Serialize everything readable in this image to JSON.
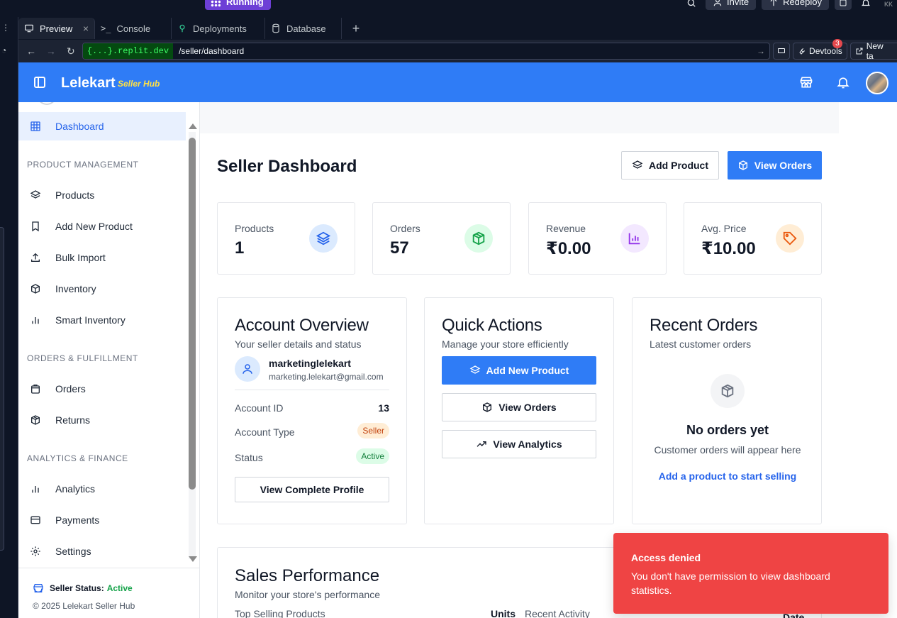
{
  "replit": {
    "run_status": "Running",
    "invite_label": "Invite",
    "redeploy_label": "Redeploy",
    "tabs": [
      {
        "label": "Preview",
        "icon": "monitor-icon"
      },
      {
        "label": "Console",
        "icon": "terminal-icon"
      },
      {
        "label": "Deployments",
        "icon": "deploy-icon"
      },
      {
        "label": "Database",
        "icon": "database-icon"
      }
    ],
    "url_domain": "{...}.replit.dev",
    "url_path": "/seller/dashboard",
    "devtools_label": "Devtools",
    "devtools_badge": "3",
    "new_tab_label": "New ta",
    "avatar_initials": "KK"
  },
  "header": {
    "brand": "Lelekart",
    "brand_sub": "Seller Hub",
    "accent": "#2f7cf6"
  },
  "sidebar": {
    "items": [
      {
        "label": "Dashboard",
        "icon": "grid-icon"
      },
      {
        "label": "Products",
        "icon": "layers-icon"
      },
      {
        "label": "Add New Product",
        "icon": "bookmark-icon"
      },
      {
        "label": "Bulk Import",
        "icon": "upload-icon"
      },
      {
        "label": "Inventory",
        "icon": "box-icon"
      },
      {
        "label": "Smart Inventory",
        "icon": "bar-chart-icon"
      },
      {
        "label": "Orders",
        "icon": "shopping-bag-icon"
      },
      {
        "label": "Returns",
        "icon": "package-icon"
      },
      {
        "label": "Analytics",
        "icon": "bar-chart-icon"
      },
      {
        "label": "Payments",
        "icon": "credit-card-icon"
      },
      {
        "label": "Settings",
        "icon": "gear-icon"
      }
    ],
    "sections": [
      "PRODUCT MANAGEMENT",
      "ORDERS & FULFILLMENT",
      "ANALYTICS & FINANCE"
    ],
    "status_label": "Seller Status:",
    "status_value": "Active",
    "copyright": "© 2025 Lelekart Seller Hub"
  },
  "main": {
    "title": "Seller Dashboard",
    "add_product": "Add Product",
    "view_orders": "View Orders",
    "stats": [
      {
        "label": "Products",
        "value": "1",
        "icon": "layers-icon",
        "color": "#2563eb",
        "bg": "#dbeafe"
      },
      {
        "label": "Orders",
        "value": "57",
        "icon": "package-icon",
        "color": "#16a34a",
        "bg": "#dcfce7"
      },
      {
        "label": "Revenue",
        "value": "₹0.00",
        "icon": "bar-chart-icon",
        "color": "#9333ea",
        "bg": "#f3e8ff"
      },
      {
        "label": "Avg. Price",
        "value": "₹10.00",
        "icon": "tag-icon",
        "color": "#ea580c",
        "bg": "#ffedd5"
      }
    ],
    "account": {
      "title": "Account Overview",
      "subtitle": "Your seller details and status",
      "username": "marketinglelekart",
      "email": "marketing.lelekart@gmail.com",
      "id_label": "Account ID",
      "id_value": "13",
      "type_label": "Account Type",
      "type_value": "Seller",
      "status_label": "Status",
      "status_value": "Active",
      "profile_button": "View Complete Profile"
    },
    "quick": {
      "title": "Quick Actions",
      "subtitle": "Manage your store efficiently",
      "add_new_product": "Add New Product",
      "view_orders": "View Orders",
      "view_analytics": "View Analytics"
    },
    "recent": {
      "title": "Recent Orders",
      "subtitle": "Latest customer orders",
      "empty_title": "No orders yet",
      "empty_sub": "Customer orders will appear here",
      "empty_link": "Add a product to start selling"
    },
    "sales": {
      "title": "Sales Performance",
      "subtitle": "Monitor your store's performance",
      "col1": "Top Selling Products",
      "col2": "Units",
      "col3": "Recent Activity",
      "col4": "Date"
    }
  },
  "toast": {
    "title": "Access denied",
    "message": "You don't have permission to view dashboard statistics.",
    "color": "#ef4444"
  }
}
